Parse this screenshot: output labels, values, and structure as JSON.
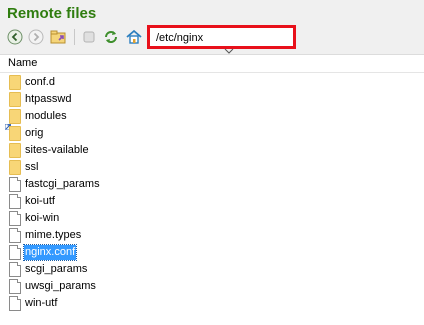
{
  "panel": {
    "title": "Remote files"
  },
  "toolbar": {
    "back_icon": "back-arrow-icon",
    "forward_icon": "forward-arrow-icon",
    "parent_folder_icon": "parent-folder-icon",
    "stop_icon": "stop-icon",
    "refresh_icon": "refresh-icon",
    "home_icon": "home-icon"
  },
  "path": {
    "value": "/etc/nginx"
  },
  "list": {
    "column_name": "Name",
    "items": [
      {
        "name": "conf.d",
        "type": "folder"
      },
      {
        "name": "htpasswd",
        "type": "folder"
      },
      {
        "name": "modules",
        "type": "folder-link"
      },
      {
        "name": "orig",
        "type": "folder"
      },
      {
        "name": "sites-vailable",
        "type": "folder"
      },
      {
        "name": "ssl",
        "type": "folder"
      },
      {
        "name": "fastcgi_params",
        "type": "file"
      },
      {
        "name": "koi-utf",
        "type": "file"
      },
      {
        "name": "koi-win",
        "type": "file"
      },
      {
        "name": "mime.types",
        "type": "file"
      },
      {
        "name": "nginx.conf",
        "type": "file",
        "selected": true
      },
      {
        "name": "scgi_params",
        "type": "file"
      },
      {
        "name": "uwsgi_params",
        "type": "file"
      },
      {
        "name": "win-utf",
        "type": "file"
      }
    ]
  },
  "colors": {
    "title": "#2f7d0f",
    "highlight_border": "#e8101a",
    "selection": "#3399ff",
    "folder": "#f8d677"
  }
}
